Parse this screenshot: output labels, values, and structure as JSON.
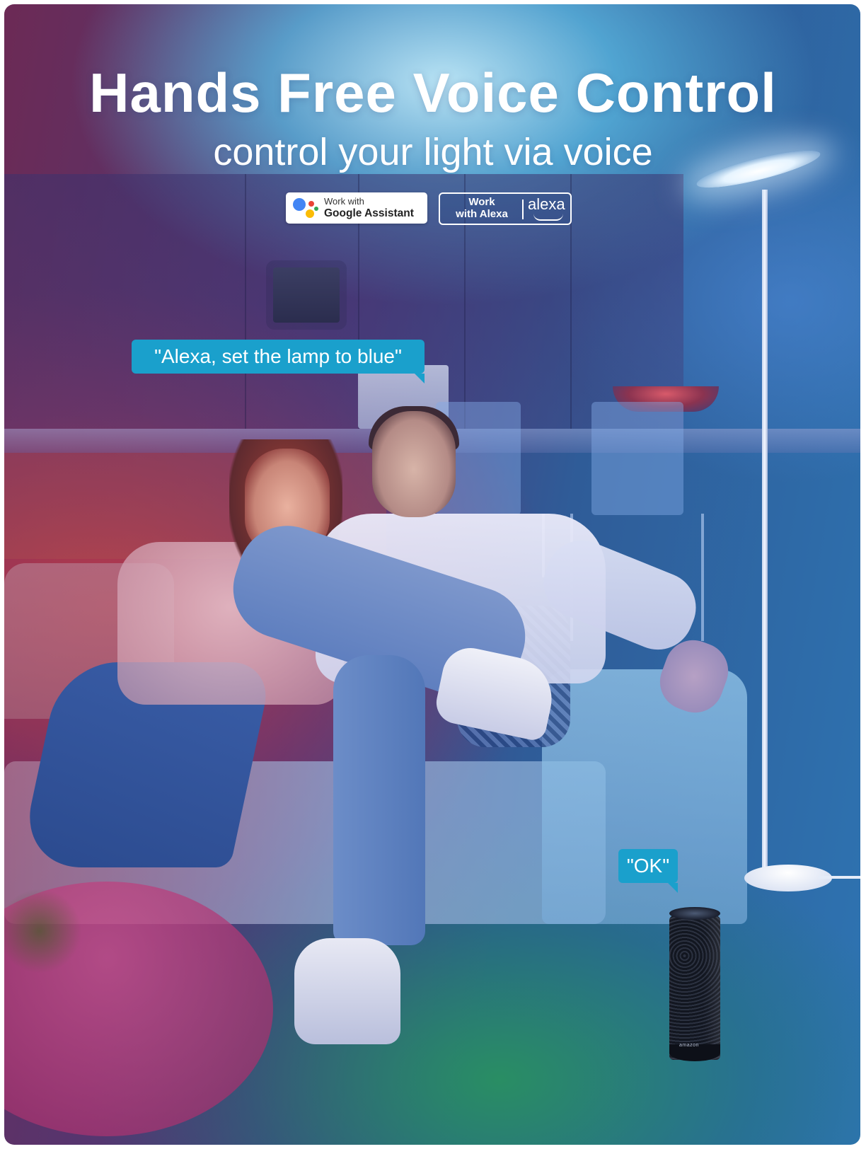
{
  "headline": {
    "title": "Hands Free Voice Control",
    "subtitle": "control your light via voice"
  },
  "badges": {
    "google": {
      "line1": "Work with",
      "line2": "Google Assistant",
      "icon": "google-assistant-icon",
      "dot_colors": [
        "#4285F4",
        "#EA4335",
        "#FBBC05",
        "#34A853"
      ]
    },
    "alexa": {
      "line1": "Work",
      "line2": "with Alexa",
      "wordmark": "alexa",
      "icon": "alexa-smile-icon"
    }
  },
  "speech": {
    "user_command": "\"Alexa, set the lamp to blue\"",
    "device_reply": "\"OK\""
  },
  "device": {
    "label": "amazon"
  },
  "colors": {
    "bubble": "#1aa0cc",
    "text": "#ffffff"
  }
}
